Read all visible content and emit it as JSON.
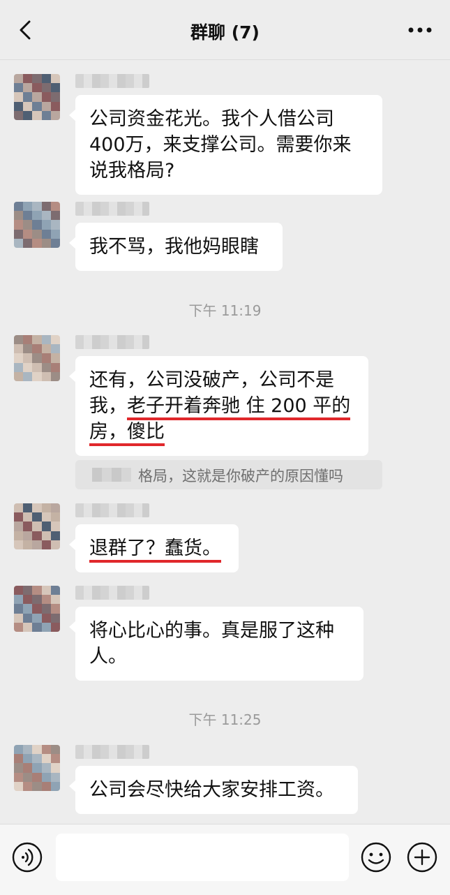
{
  "header": {
    "title": "群聊 (7)",
    "back_icon": "chevron-left-icon",
    "more_icon": "more-dots-icon"
  },
  "messages": [
    {
      "lines": [
        "公司资金花光。我个人借公司",
        "400万，来支撑公司。需要你来",
        "说我格局?"
      ]
    },
    {
      "lines": [
        "我不骂，我他妈眼瞎"
      ]
    },
    {
      "line1": "还有，公司没破产，公司不是",
      "line2_plain": "我，",
      "line2_underlined": "老子开着奔驰 住 200 平的",
      "line3_underlined": "房，傻比"
    },
    {
      "underlined": "退群了？蠢货。"
    },
    {
      "lines": [
        "将心比心的事。真是服了这种",
        "人。"
      ]
    },
    {
      "lines": [
        "公司会尽快给大家安排工资。"
      ]
    }
  ],
  "timestamps": [
    "下午 11:19",
    "下午 11:25"
  ],
  "quote": {
    "text": "格局，这就是你破产的原因懂吗"
  },
  "footer": {
    "voice_icon": "voice-icon",
    "emoji_icon": "emoji-icon",
    "plus_icon": "plus-icon"
  },
  "colors": {
    "background": "#ededed",
    "bubble": "#ffffff",
    "underline": "#e0282c",
    "timestamp": "#9a9a9a"
  }
}
